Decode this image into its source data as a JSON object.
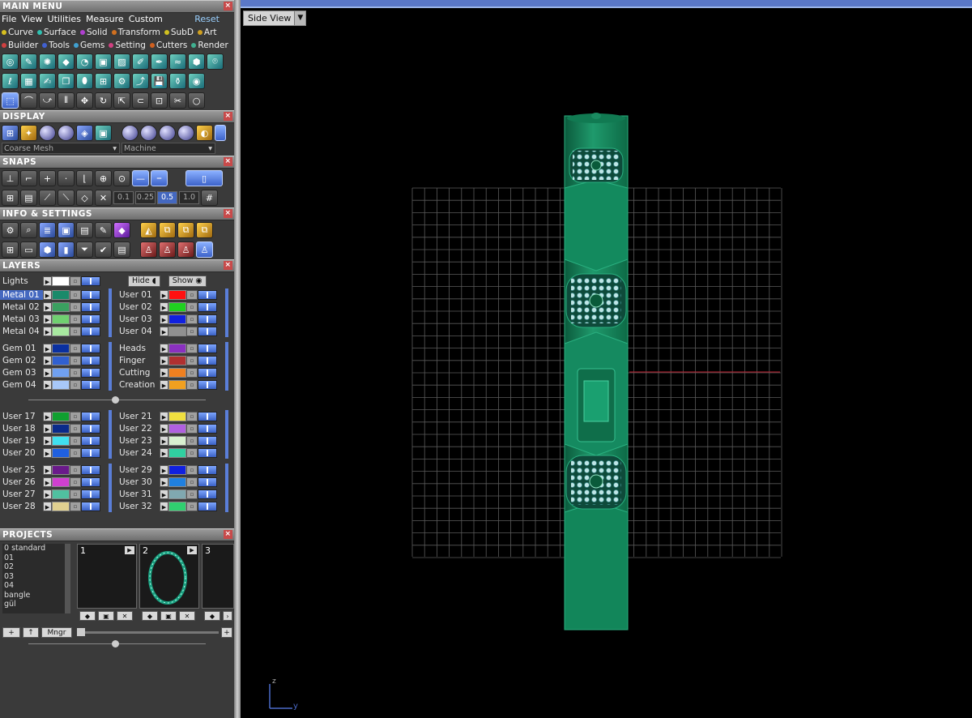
{
  "main_menu": {
    "title": "MAIN MENU",
    "menus": [
      "File",
      "View",
      "Utilities",
      "Measure",
      "Custom"
    ],
    "reset": "Reset",
    "modules_row1": [
      {
        "label": "Curve",
        "color": "#d8c020"
      },
      {
        "label": "Surface",
        "color": "#30c0b0"
      },
      {
        "label": "Solid",
        "color": "#b040d0"
      },
      {
        "label": "Transform",
        "color": "#d07020"
      },
      {
        "label": "SubD",
        "color": "#d0c020"
      },
      {
        "label": "Art",
        "color": "#d0a020"
      }
    ],
    "modules_row2": [
      {
        "label": "Builder",
        "color": "#d04040"
      },
      {
        "label": "Tools",
        "color": "#4060d0"
      },
      {
        "label": "Gems",
        "color": "#40a0d0"
      },
      {
        "label": "Setting",
        "color": "#d04080"
      },
      {
        "label": "Cutters",
        "color": "#d06020"
      },
      {
        "label": "Render",
        "color": "#40b090"
      }
    ]
  },
  "display": {
    "title": "DISPLAY",
    "mesh_select": "Coarse Mesh",
    "render_select": "Machine"
  },
  "snaps": {
    "title": "SNAPS",
    "values": [
      "0.1",
      "0.25",
      "0.5",
      "1.0"
    ],
    "selected_value": "0.5"
  },
  "info": {
    "title": "INFO & SETTINGS"
  },
  "layers": {
    "title": "LAYERS",
    "lights_label": "Lights",
    "hide_label": "Hide",
    "show_label": "Show",
    "group1_left": [
      {
        "name": "Metal 01",
        "color": "#1a8a6a",
        "selected": true
      },
      {
        "name": "Metal 02",
        "color": "#3aa060"
      },
      {
        "name": "Metal 03",
        "color": "#70d070"
      },
      {
        "name": "Metal 04",
        "color": "#a8e8a0"
      }
    ],
    "group1_right": [
      {
        "name": "User 01",
        "color": "#ff1010"
      },
      {
        "name": "User 02",
        "color": "#20d020"
      },
      {
        "name": "User 03",
        "color": "#1020e0"
      },
      {
        "name": "User 04",
        "color": "#909090"
      }
    ],
    "group2_left": [
      {
        "name": "Gem 01",
        "color": "#0a30a0"
      },
      {
        "name": "Gem 02",
        "color": "#3060d0"
      },
      {
        "name": "Gem 03",
        "color": "#70a0f0"
      },
      {
        "name": "Gem 04",
        "color": "#a8c8f8"
      }
    ],
    "group2_right": [
      {
        "name": "Heads",
        "color": "#8a30c0"
      },
      {
        "name": "Finger",
        "color": "#b03030"
      },
      {
        "name": "Cutting",
        "color": "#f08020"
      },
      {
        "name": "Creation",
        "color": "#f0a020"
      }
    ],
    "group3_left": [
      {
        "name": "User 17",
        "color": "#10a030"
      },
      {
        "name": "User 18",
        "color": "#0a2a8a"
      },
      {
        "name": "User 19",
        "color": "#40e0f0"
      },
      {
        "name": "User 20",
        "color": "#2060e0"
      }
    ],
    "group3_right": [
      {
        "name": "User 21",
        "color": "#f0e040"
      },
      {
        "name": "User 22",
        "color": "#b060e0"
      },
      {
        "name": "User 23",
        "color": "#d8f0d0"
      },
      {
        "name": "User 24",
        "color": "#30d0a0"
      }
    ],
    "group4_left": [
      {
        "name": "User 25",
        "color": "#6a1a8a"
      },
      {
        "name": "User 26",
        "color": "#d040d0"
      },
      {
        "name": "User 27",
        "color": "#50c0a0"
      },
      {
        "name": "User 28",
        "color": "#e0d090"
      }
    ],
    "group4_right": [
      {
        "name": "User 29",
        "color": "#1020e0"
      },
      {
        "name": "User 30",
        "color": "#2080e0"
      },
      {
        "name": "User 31",
        "color": "#80a8b0"
      },
      {
        "name": "User 32",
        "color": "#30d070"
      }
    ]
  },
  "projects": {
    "title": "PROJECTS",
    "list": [
      "0 standard",
      "01",
      "02",
      "03",
      "04",
      "bangle",
      "gül"
    ],
    "slots": [
      "1",
      "2",
      "3"
    ],
    "add_label": "+",
    "up_label": "↑",
    "mngr_label": "Mngr"
  },
  "viewport": {
    "view_name": "Side View",
    "axis_z": "z",
    "axis_y": "y"
  }
}
